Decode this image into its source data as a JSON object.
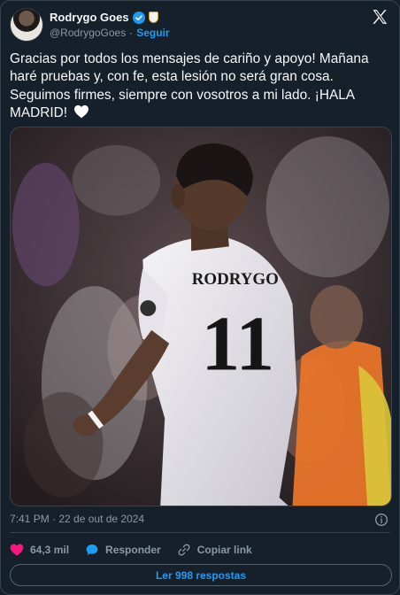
{
  "header": {
    "display_name": "Rodrygo Goes",
    "handle": "@RodrygoGoes",
    "separator": "·",
    "follow_label": "Seguir"
  },
  "tweet": {
    "text": "Gracias por todos los mensajes de cariño y apoyo! Mañana haré pruebas y, con fe, esta lesión no será gran cosa. Seguimos firmes, siempre con vosotros a mi lado. ¡HALA MADRID!",
    "emoji": "white-heart",
    "photo": {
      "jersey_name": "RODRYGO",
      "jersey_number": "11"
    }
  },
  "meta": {
    "timestamp": "7:41 PM · 22 de out de 2024"
  },
  "actions": {
    "like_count": "64,3 mil",
    "reply_label": "Responder",
    "copy_link_label": "Copiar link"
  },
  "replies_button": {
    "label": "Ler 998 respostas"
  },
  "colors": {
    "background": "#15202b",
    "accent": "#1d9bf0",
    "like": "#f91880",
    "muted_text": "#8b98a5",
    "border": "#38444d"
  }
}
